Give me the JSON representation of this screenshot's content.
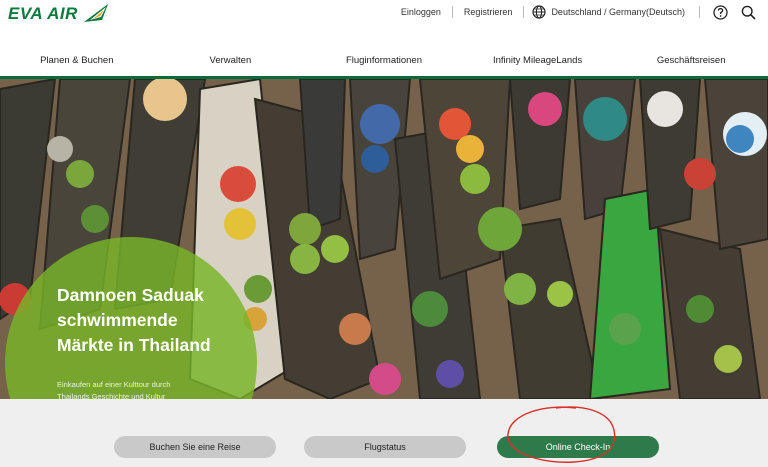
{
  "brand": {
    "logo_text": "EVA AIR",
    "accent_color": "#0b7a3e"
  },
  "top_links": {
    "login": "Einloggen",
    "register": "Registrieren",
    "language": "Deutschland / Germany(Deutsch)"
  },
  "icons": {
    "globe": "globe-icon",
    "help": "question-icon",
    "search": "search-icon"
  },
  "main_nav": [
    {
      "label": "Planen & Buchen"
    },
    {
      "label": "Verwalten"
    },
    {
      "label": "Fluginformationen"
    },
    {
      "label": "Infinity MileageLands"
    },
    {
      "label": "Geschäftsreisen"
    }
  ],
  "hero": {
    "title_line1": "Damnoen Saduak",
    "title_line2": "schwimmende",
    "title_line3": "Märkte in Thailand",
    "subtitle_line1": "Einkaufen auf einer Kulttour durch",
    "subtitle_line2": "Thailands Geschichte und Kultur"
  },
  "quick_actions": {
    "book": "Buchen Sie eine Reise",
    "status": "Flugstatus",
    "checkin": "Online Check-In"
  }
}
